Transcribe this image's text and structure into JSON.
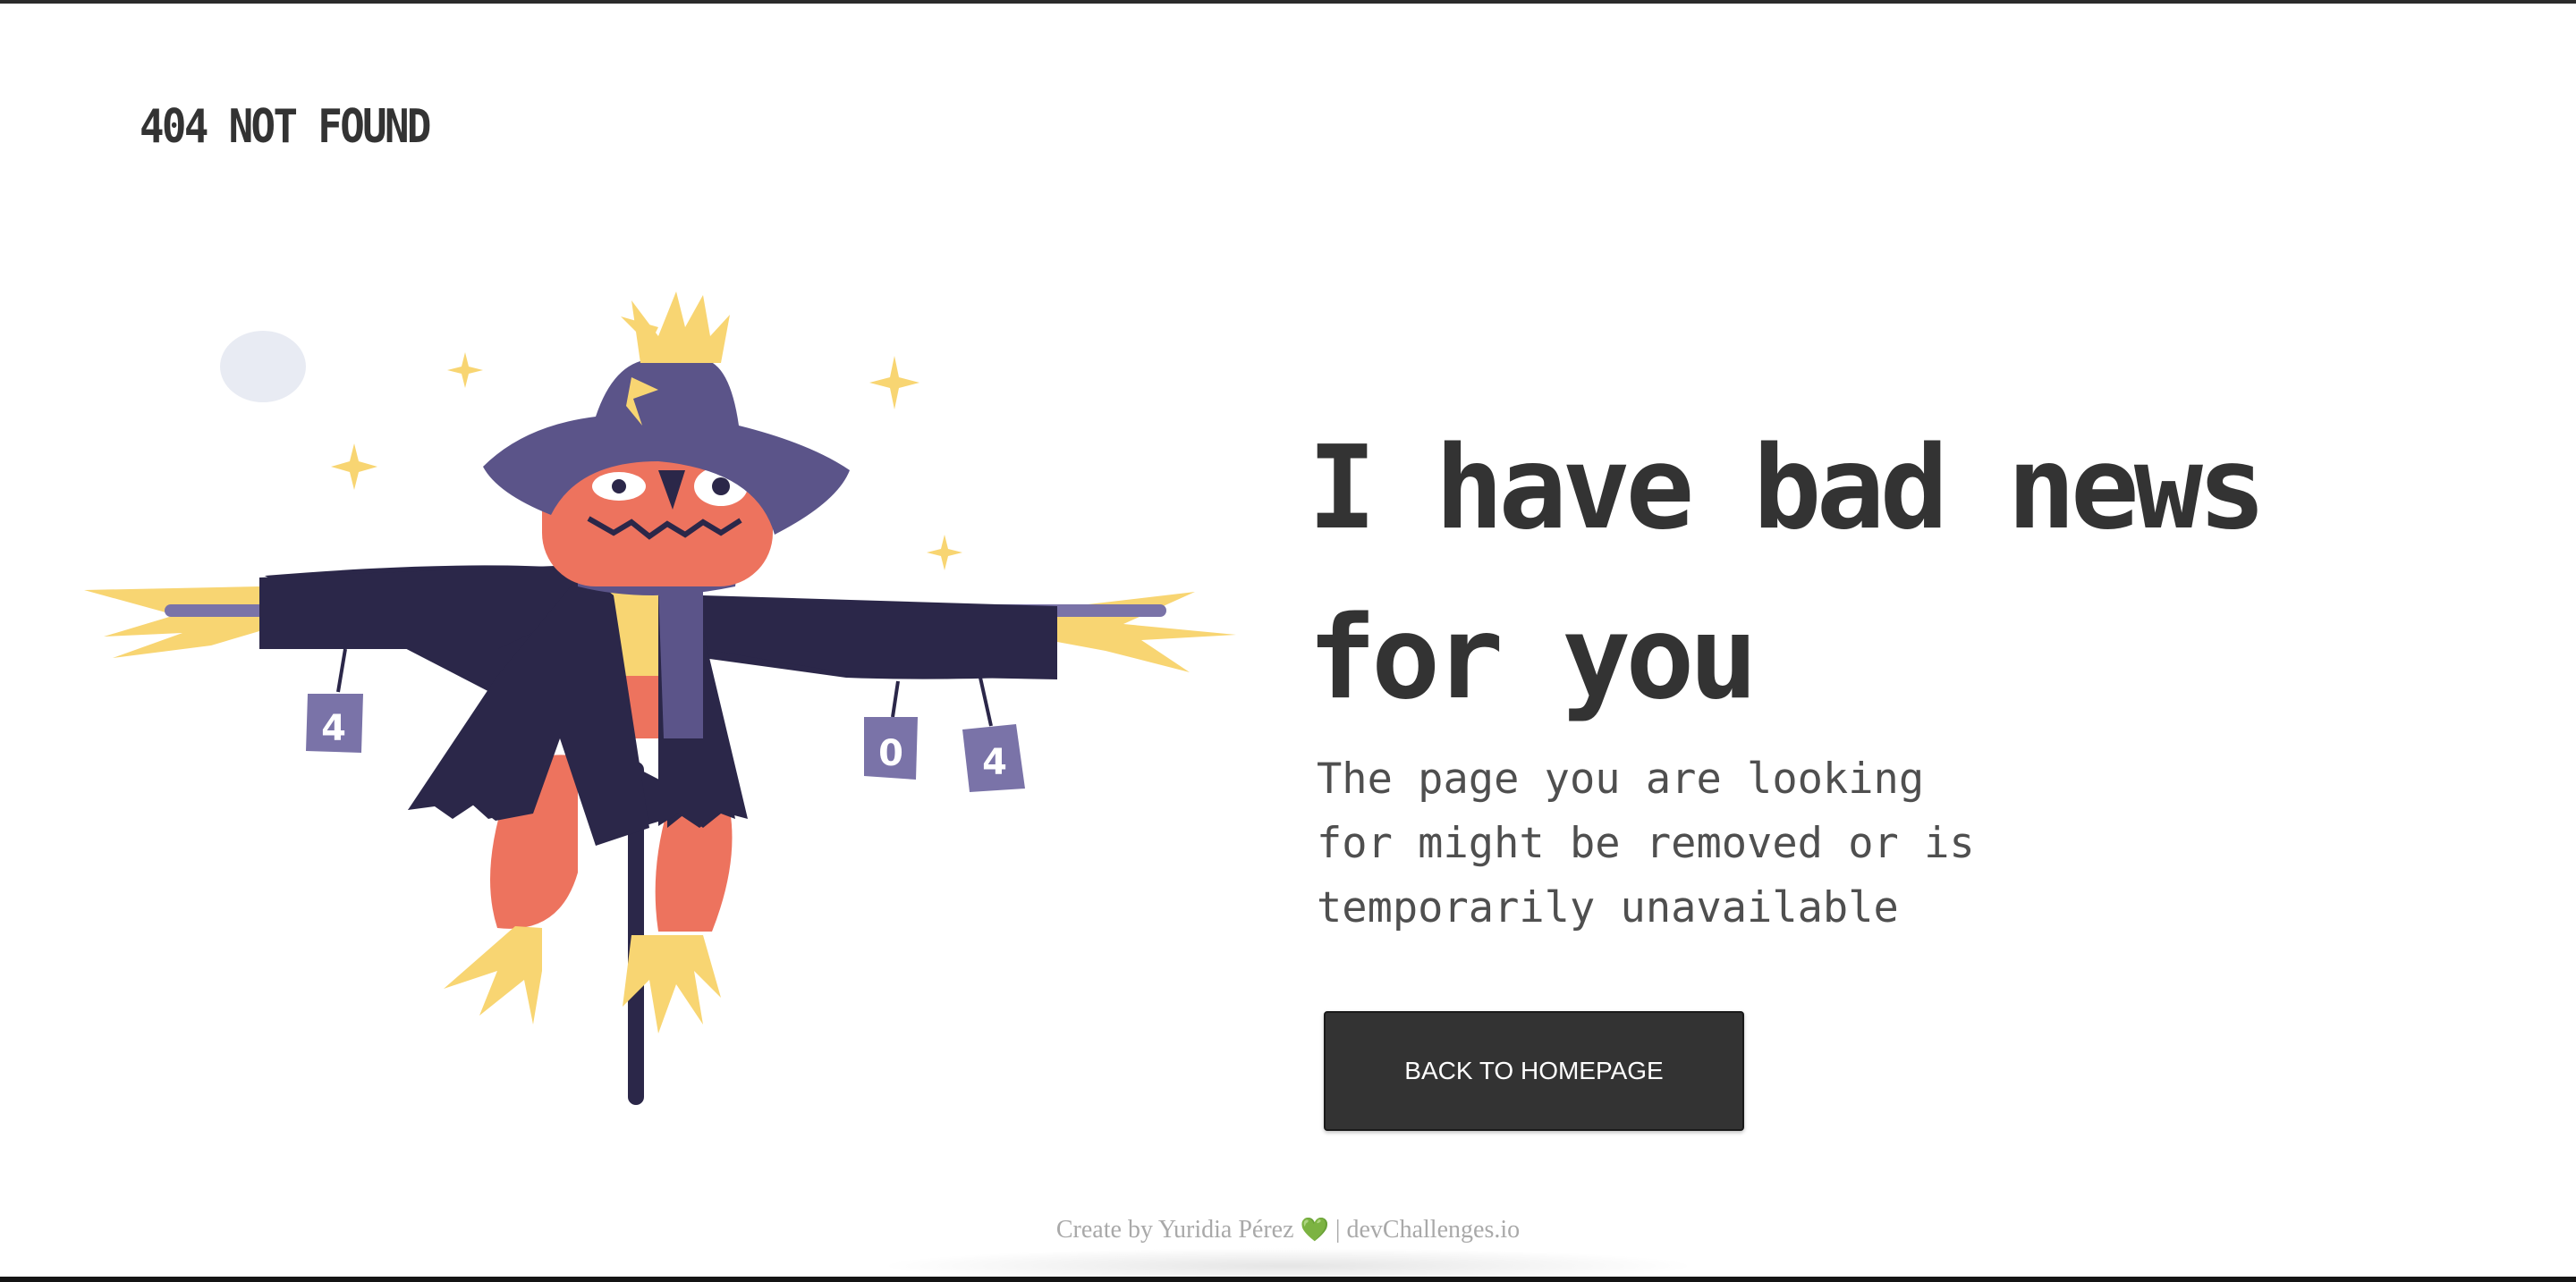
{
  "header": {
    "brand": "404 NOT FOUND"
  },
  "illustration": {
    "can_labels": [
      "4",
      "0",
      "4"
    ],
    "colors": {
      "coat": "#2b2749",
      "hat": "#5b5489",
      "face": "#ed735e",
      "straw": "#f8d572",
      "can": "#7a73a8",
      "moon": "#e8ebf3"
    }
  },
  "main": {
    "headline_line1": "I have bad news",
    "headline_line2": "for you",
    "message_line1": "The page you are looking",
    "message_line2": "for might be removed or is",
    "message_line3": "temporarily unavailable",
    "button_label": "BACK TO HOMEPAGE"
  },
  "footer": {
    "created_prefix": "Create by Yuridia Pérez",
    "heart": "💚",
    "separator": "|",
    "site": "devChallenges.io"
  },
  "colors": {
    "text": "#333333",
    "muted_text": "#4f4f4f",
    "button_bg": "#333333",
    "button_text": "#ffffff",
    "footer_text": "#a9a9a9"
  }
}
